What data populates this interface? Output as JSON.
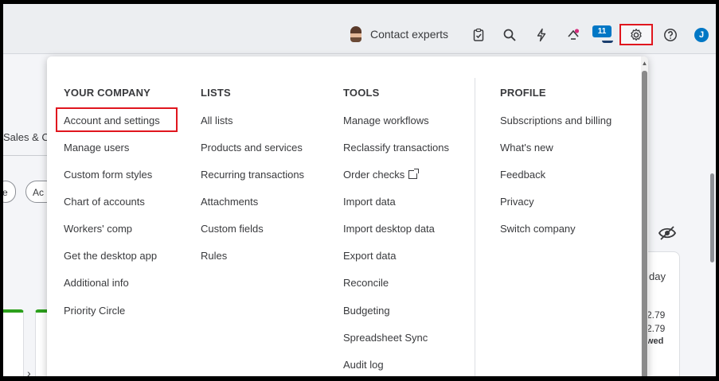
{
  "topbar": {
    "contact_label": "Contact experts",
    "notification_count": "11",
    "user_initial": "J",
    "icons": [
      "clipboard-icon",
      "search-icon",
      "lightning-icon",
      "apps-icon",
      "bell-icon",
      "gear-icon",
      "help-icon"
    ]
  },
  "background": {
    "tab_label": "Sales & C",
    "pill_a": "e",
    "pill_b": "Ac",
    "right_card": {
      "line1": "day",
      "line2": "2.79",
      "line3": "2.79",
      "line4": "wed"
    }
  },
  "menu": {
    "columns": [
      {
        "title": "YOUR COMPANY",
        "items": [
          "Account and settings",
          "Manage users",
          "Custom form styles",
          "Chart of accounts",
          "Workers' comp",
          "Get the desktop app",
          "Additional info",
          "Priority Circle"
        ]
      },
      {
        "title": "LISTS",
        "items": [
          "All lists",
          "Products and services",
          "Recurring transactions",
          "Attachments",
          "Custom fields",
          "Rules"
        ]
      },
      {
        "title": "TOOLS",
        "items": [
          "Manage workflows",
          "Reclassify transactions",
          "Order checks",
          "Import data",
          "Import desktop data",
          "Export data",
          "Reconcile",
          "Budgeting",
          "Spreadsheet Sync",
          "Audit log"
        ]
      },
      {
        "title": "PROFILE",
        "items": [
          "Subscriptions and billing",
          "What's new",
          "Feedback",
          "Privacy",
          "Switch company"
        ]
      }
    ],
    "highlighted_item": "Account and settings"
  },
  "colors": {
    "highlight_red": "#e0161e",
    "brand_blue": "#0077c5",
    "brand_green": "#2ca01c"
  }
}
